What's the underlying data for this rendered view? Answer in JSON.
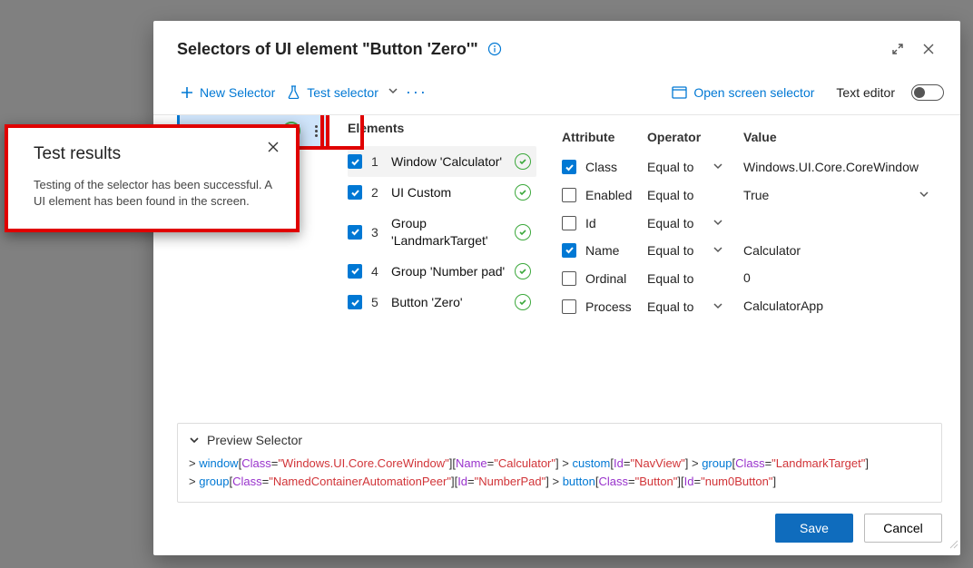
{
  "dialog": {
    "title": "Selectors of UI element \"Button 'Zero'\""
  },
  "toolbar": {
    "newSelector": "New Selector",
    "testSelector": "Test selector",
    "openScreen": "Open screen selector",
    "textEditor": "Text editor"
  },
  "panels": {
    "elementsHeading": "Elements"
  },
  "elements": [
    {
      "num": "1",
      "label": "Window 'Calculator'"
    },
    {
      "num": "2",
      "label": "UI Custom"
    },
    {
      "num": "3",
      "label": "Group 'LandmarkTarget'"
    },
    {
      "num": "4",
      "label": "Group 'Number pad'"
    },
    {
      "num": "5",
      "label": "Button 'Zero'"
    }
  ],
  "attrHead": {
    "attribute": "Attribute",
    "operator": "Operator",
    "value": "Value"
  },
  "attributes": [
    {
      "checked": true,
      "name": "Class",
      "op": "Equal to",
      "hasDd": true,
      "value": "Windows.UI.Core.CoreWindow",
      "valDd": false
    },
    {
      "checked": false,
      "name": "Enabled",
      "op": "Equal to",
      "hasDd": false,
      "value": "True",
      "valDd": true
    },
    {
      "checked": false,
      "name": "Id",
      "op": "Equal to",
      "hasDd": true,
      "value": "",
      "valDd": false
    },
    {
      "checked": true,
      "name": "Name",
      "op": "Equal to",
      "hasDd": true,
      "value": "Calculator",
      "valDd": false
    },
    {
      "checked": false,
      "name": "Ordinal",
      "op": "Equal to",
      "hasDd": false,
      "value": "0",
      "valDd": false
    },
    {
      "checked": false,
      "name": "Process",
      "op": "Equal to",
      "hasDd": true,
      "value": "CalculatorApp",
      "valDd": false
    }
  ],
  "preview": {
    "label": "Preview Selector",
    "segments": [
      {
        "gt": "> ",
        "tag": "window",
        "parts": [
          {
            "attr": "Class",
            "val": "\"Windows.UI.Core.CoreWindow\""
          },
          {
            "attr": "Name",
            "val": "\"Calculator\""
          }
        ]
      },
      {
        "gt": " > ",
        "tag": "custom",
        "parts": [
          {
            "attr": "Id",
            "val": "\"NavView\""
          }
        ]
      },
      {
        "gt": " > ",
        "tag": "group",
        "parts": [
          {
            "attr": "Class",
            "val": "\"LandmarkTarget\""
          }
        ]
      },
      {
        "gt": "> ",
        "tag": "group",
        "parts": [
          {
            "attr": "Class",
            "val": "\"NamedContainerAutomationPeer\""
          },
          {
            "attr": "Id",
            "val": "\"NumberPad\""
          }
        ]
      },
      {
        "gt": " > ",
        "tag": "button",
        "parts": [
          {
            "attr": "Class",
            "val": "\"Button\""
          },
          {
            "attr": "Id",
            "val": "\"num0Button\""
          }
        ]
      }
    ]
  },
  "buttons": {
    "save": "Save",
    "cancel": "Cancel"
  },
  "toast": {
    "title": "Test results",
    "body": "Testing of the selector has been successful. A UI element has been found in the screen."
  }
}
